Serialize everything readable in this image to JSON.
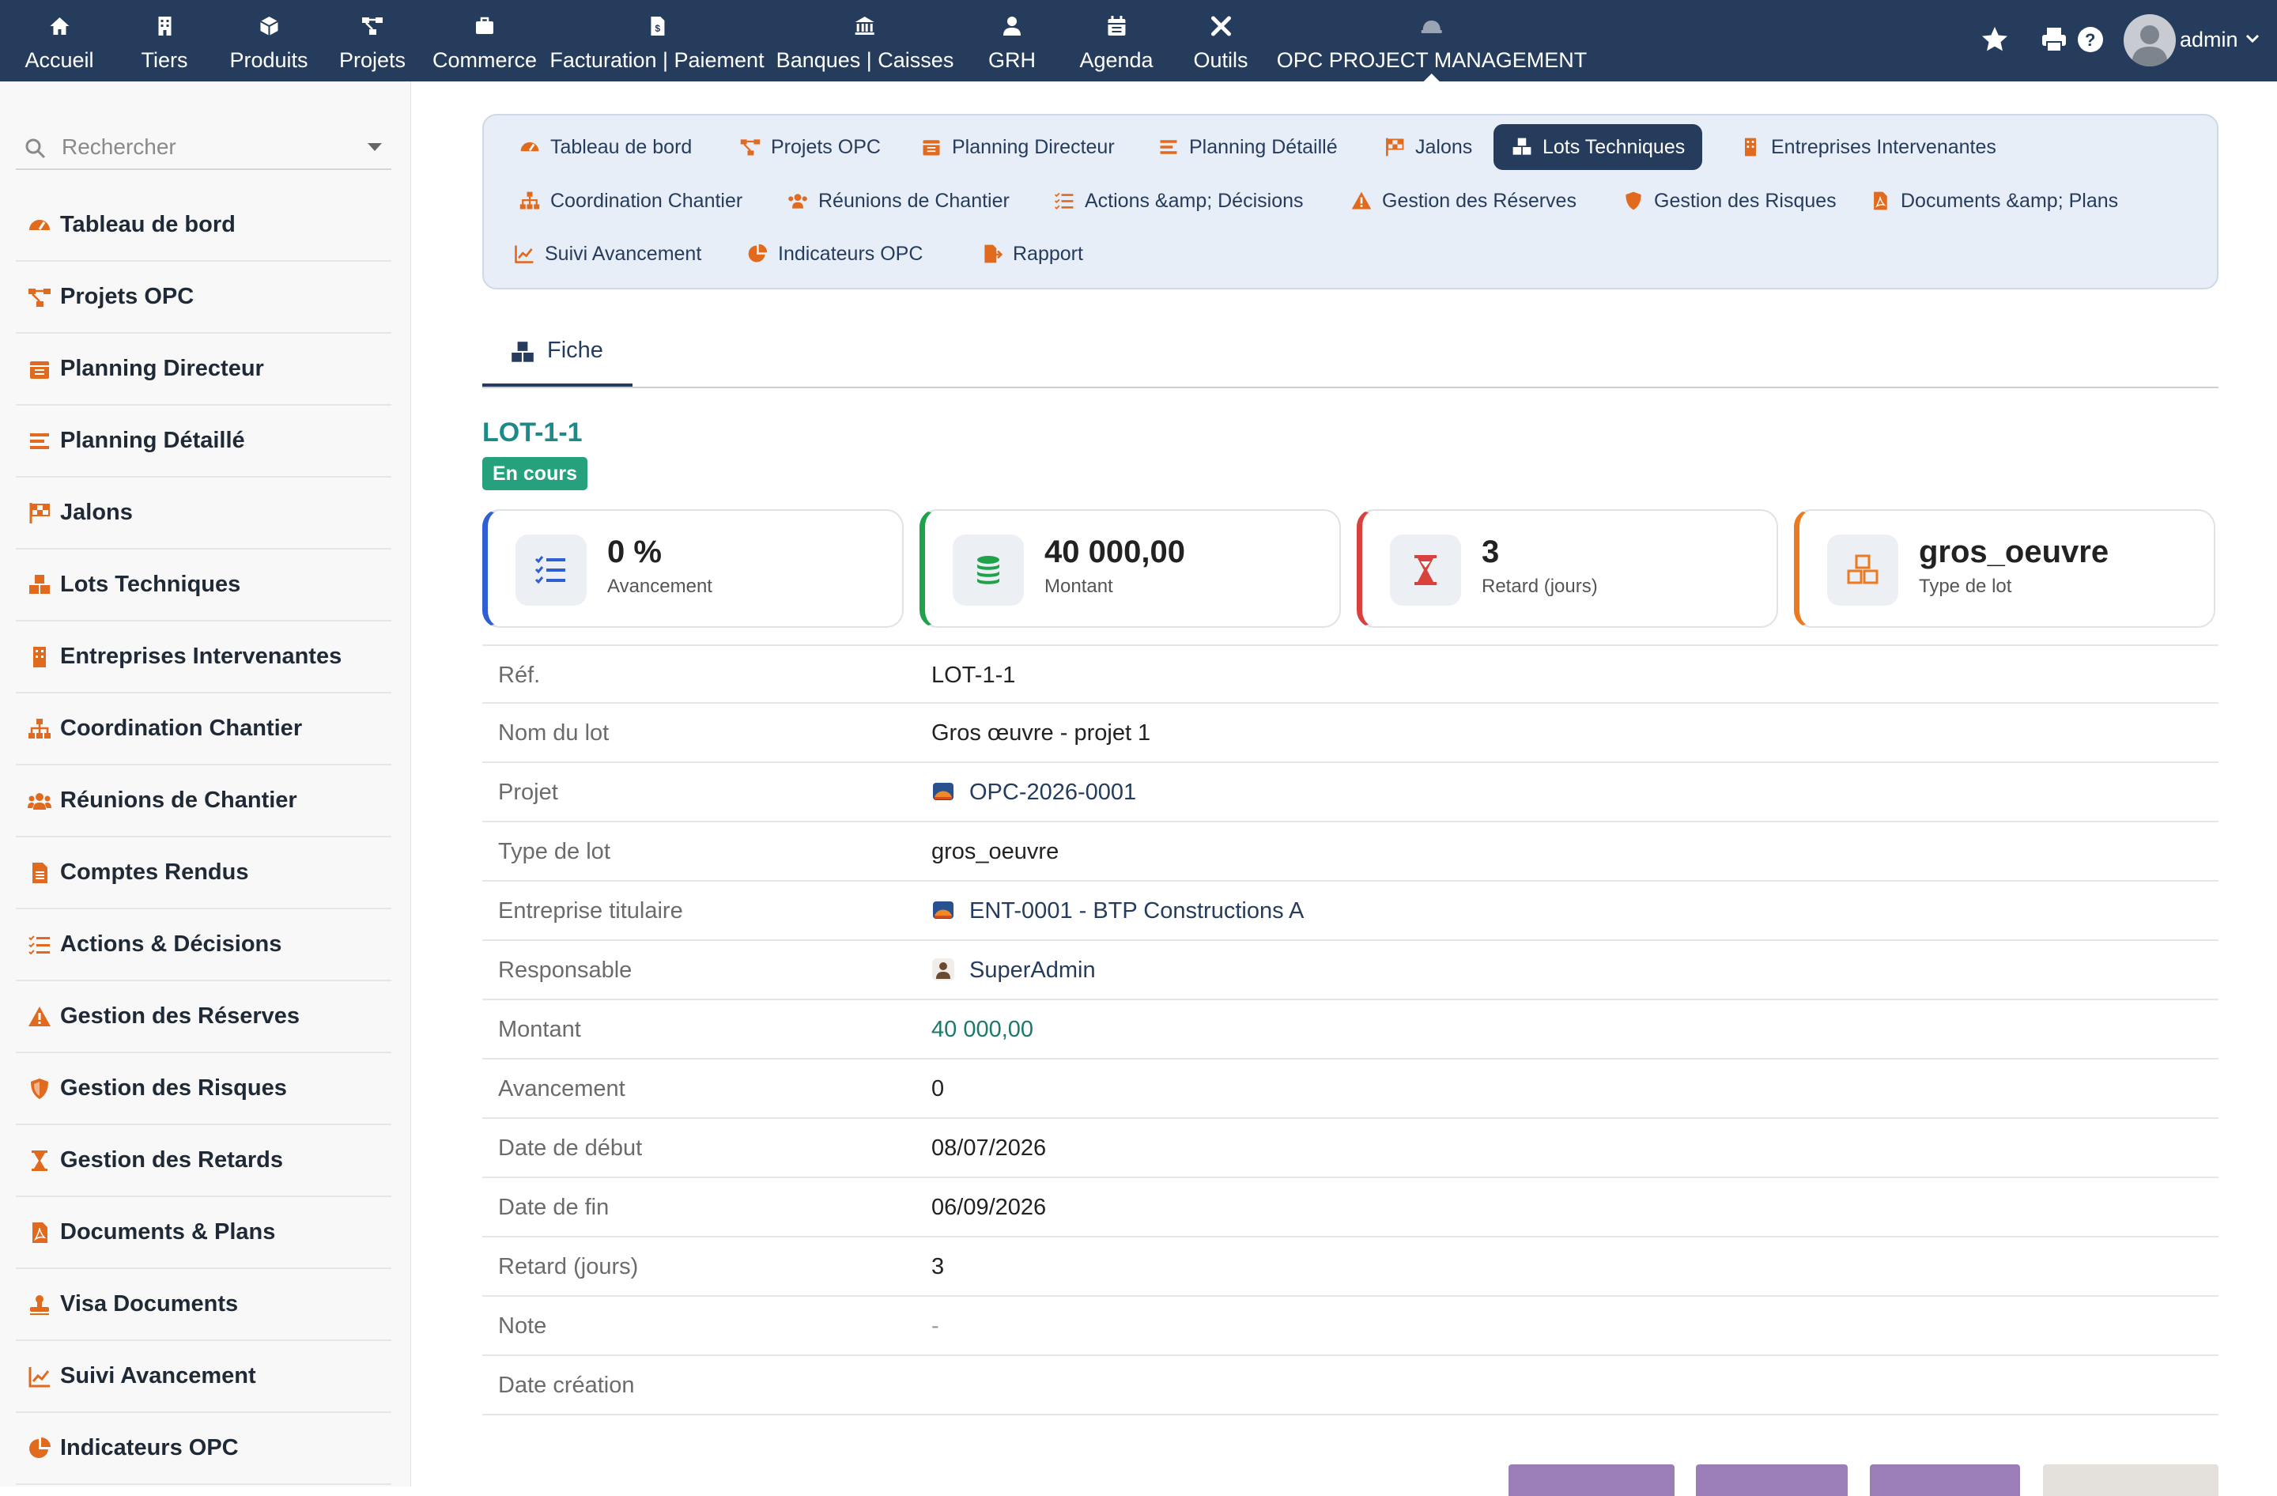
{
  "topnav": {
    "items": [
      {
        "label": "Accueil",
        "icon": "home-icon"
      },
      {
        "label": "Tiers",
        "icon": "building-icon"
      },
      {
        "label": "Produits",
        "icon": "cube-icon"
      },
      {
        "label": "Projets",
        "icon": "sitemap-icon"
      },
      {
        "label": "Commerce",
        "icon": "briefcase-icon"
      },
      {
        "label": "Facturation | Paiement",
        "icon": "invoice-icon"
      },
      {
        "label": "Banques | Caisses",
        "icon": "bank-icon"
      },
      {
        "label": "GRH",
        "icon": "user-tie-icon"
      },
      {
        "label": "Agenda",
        "icon": "calendar-icon"
      },
      {
        "label": "Outils",
        "icon": "tools-icon"
      },
      {
        "label": "OPC PROJECT MANAGEMENT",
        "icon": "hardhat-icon"
      }
    ],
    "user": "admin"
  },
  "sidebar": {
    "search_placeholder": "Rechercher",
    "items": [
      {
        "label": "Tableau de bord",
        "icon": "dashboard-icon"
      },
      {
        "label": "Projets OPC",
        "icon": "project-diagram-icon"
      },
      {
        "label": "Planning Directeur",
        "icon": "calendar-icon"
      },
      {
        "label": "Planning Détaillé",
        "icon": "list-bars-icon"
      },
      {
        "label": "Jalons",
        "icon": "flag-checkered-icon"
      },
      {
        "label": "Lots Techniques",
        "icon": "cubes-icon"
      },
      {
        "label": "Entreprises Intervenantes",
        "icon": "building-icon"
      },
      {
        "label": "Coordination Chantier",
        "icon": "sitemap-icon"
      },
      {
        "label": "Réunions de Chantier",
        "icon": "users-icon"
      },
      {
        "label": "Comptes Rendus",
        "icon": "file-text-icon"
      },
      {
        "label": "Actions & Décisions",
        "icon": "tasks-icon"
      },
      {
        "label": "Gestion des Réserves",
        "icon": "warning-icon"
      },
      {
        "label": "Gestion des Risques",
        "icon": "shield-icon"
      },
      {
        "label": "Gestion des Retards",
        "icon": "hourglass-icon"
      },
      {
        "label": "Documents & Plans",
        "icon": "file-pdf-icon"
      },
      {
        "label": "Visa Documents",
        "icon": "stamp-icon"
      },
      {
        "label": "Suivi Avancement",
        "icon": "chart-line-icon"
      },
      {
        "label": "Indicateurs OPC",
        "icon": "chart-pie-icon"
      }
    ]
  },
  "tabs": {
    "items": [
      {
        "label": "Tableau de bord",
        "icon": "dashboard-icon"
      },
      {
        "label": "Projets OPC",
        "icon": "project-diagram-icon"
      },
      {
        "label": "Planning Directeur",
        "icon": "calendar-icon"
      },
      {
        "label": "Planning Détaillé",
        "icon": "list-bars-icon"
      },
      {
        "label": "Jalons",
        "icon": "flag-checkered-icon"
      },
      {
        "label": "Lots Techniques",
        "icon": "cubes-icon",
        "active": true
      },
      {
        "label": "Entreprises Intervenantes",
        "icon": "building-icon"
      },
      {
        "label": "Coordination Chantier",
        "icon": "sitemap-icon"
      },
      {
        "label": "Réunions de Chantier",
        "icon": "users-icon"
      },
      {
        "label": "Actions &amp; Décisions",
        "icon": "tasks-icon"
      },
      {
        "label": "Gestion des Réserves",
        "icon": "warning-icon"
      },
      {
        "label": "Gestion des Risques",
        "icon": "shield-icon"
      },
      {
        "label": "Documents &amp; Plans",
        "icon": "file-pdf-icon"
      },
      {
        "label": "Suivi Avancement",
        "icon": "chart-line-icon"
      },
      {
        "label": "Indicateurs OPC",
        "icon": "chart-pie-icon"
      },
      {
        "label": "Rapport",
        "icon": "file-export-icon"
      }
    ]
  },
  "fiche_tab": {
    "label": "Fiche"
  },
  "lot": {
    "ref": "LOT-1-1",
    "status": "En cours",
    "colors": {
      "teal": "#1d8a8a",
      "status": "#25a27d"
    }
  },
  "cards": [
    {
      "value": "0 %",
      "label": "Avancement",
      "color": "#2f5fd3",
      "icon": "tasks-icon"
    },
    {
      "value": "40 000,00",
      "label": "Montant",
      "color": "#1fa24a",
      "icon": "coins-icon"
    },
    {
      "value": "3",
      "label": "Retard (jours)",
      "color": "#d9413c",
      "icon": "hourglass-icon"
    },
    {
      "value": "gros_oeuvre",
      "label": "Type de lot",
      "color": "#ec7a21",
      "icon": "cubes-icon"
    }
  ],
  "fields": [
    {
      "label": "Réf.",
      "value": "LOT-1-1"
    },
    {
      "label": "Nom du lot",
      "value": "Gros œuvre - projet 1"
    },
    {
      "label": "Projet",
      "value": "OPC-2026-0001",
      "icon": "project-icon"
    },
    {
      "label": "Type de lot",
      "value": "gros_oeuvre"
    },
    {
      "label": "Entreprise titulaire",
      "value": "ENT-0001 - BTP Constructions A",
      "icon": "company-icon"
    },
    {
      "label": "Responsable",
      "value": "SuperAdmin",
      "icon": "user-icon"
    },
    {
      "label": "Montant",
      "value": "40 000,00"
    },
    {
      "label": "Avancement",
      "value": "0"
    },
    {
      "label": "Date de début",
      "value": "08/07/2026"
    },
    {
      "label": "Date de fin",
      "value": "06/09/2026"
    },
    {
      "label": "Retard (jours)",
      "value": "3"
    },
    {
      "label": "Note",
      "value": "-"
    },
    {
      "label": "Date création",
      "value": ""
    }
  ]
}
